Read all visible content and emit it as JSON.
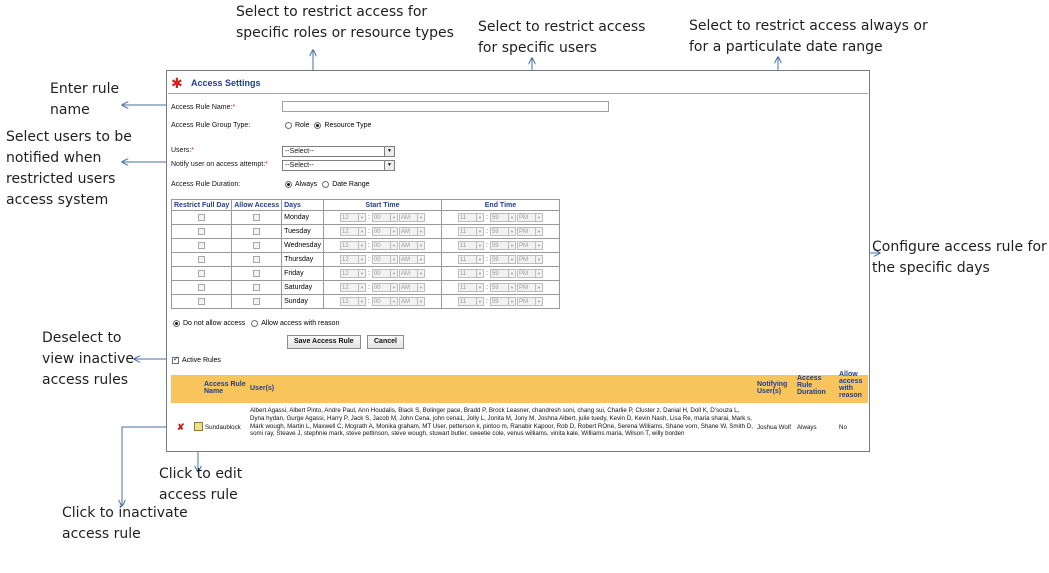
{
  "callouts": {
    "roles": [
      "Select to restrict access for",
      "specific roles or resource types"
    ],
    "users": [
      "Select to restrict access",
      "for specific users"
    ],
    "duration": [
      "Select to restrict access always or",
      "for a particulate date range"
    ],
    "rule_name": [
      "Enter rule",
      "name"
    ],
    "notify": [
      "Select users to be",
      "notified when",
      "restricted users",
      "access system"
    ],
    "days": [
      "Configure access rule for",
      "the specific days"
    ],
    "inactive": [
      "Deselect to",
      "view inactive",
      "access rules"
    ],
    "edit": [
      "Click to edit",
      "access rule"
    ],
    "inactivate": [
      "Click to inactivate",
      "access rule"
    ]
  },
  "panel": {
    "title": "Access Settings",
    "rule_name_label": "Access Rule Name:",
    "required_mark": "*",
    "group_type_label": "Access Rule Group Type:",
    "group_type_options": [
      "Role",
      "Resource Type"
    ],
    "group_type_selected": "Resource Type",
    "users_label": "Users:",
    "users_value": "--Select--",
    "notify_label": "Notify user on access attempt:",
    "notify_value": "--Select--",
    "duration_label": "Access Rule Duration:",
    "duration_options": [
      "Always",
      "Date Range"
    ],
    "duration_selected": "Always"
  },
  "schedule": {
    "headers": [
      "Restrict Full Day",
      "Allow Access",
      "Days",
      "Start Time",
      "End Time"
    ],
    "days": [
      "Monday",
      "Tuesday",
      "Wednesday",
      "Thursday",
      "Friday",
      "Saturday",
      "Sunday"
    ],
    "start": {
      "hour": "12",
      "minute": "00",
      "ampm": "AM"
    },
    "end": {
      "hour": "11",
      "minute": "59",
      "ampm": "PM"
    }
  },
  "access_options": [
    "Do not allow access",
    "Allow access with reason"
  ],
  "access_selected": "Do not allow access",
  "buttons": {
    "save": "Save Access Rule",
    "cancel": "Cancel"
  },
  "active_rules_label": "Active Rules",
  "rules_table": {
    "headers": {
      "name": "Access Rule Name",
      "users": "User(s)",
      "notifying": "Notifying User(s)",
      "duration": "Access Rule Duration",
      "allow": "Allow access with reason"
    },
    "rows": [
      {
        "name": "Sundaublock",
        "users": "Albert Agassi, Albert Pinto, Andre Paul, Ann Houdalis, Black S, Bolinger pace, Bradd P, Brock Leasner, chandresh soni, chang sui, Charlie P, Cluster z, Danial H, Doll K, D'souza L, Dyna hydan, Gurge Agassi, Harry P, Jack S, Jacob M, John Cena, john cena1, Jolly L, Jonita M, Jony M, Joshna Albert, julie tuedy, Kevin D, Kevin Nash, Lisa Re, maria sharai, Mark s, Mark wough, Martin L, Maxwell C, Mcgrath A, Monika graham, MT User, petterson k, pintoo m, Ranabir Kapoor, Rob D, Robert ROne, Serena Williams, Shane vorn, Shane W, Smith D, somi ray, Steave J, stephnie mark, steve pettinson, steve wough, stuwart butler, sweetie cole, venus williams, vinita kale, Williams maria, Wilson T, willy borden",
        "notifying": "Joshua Wolf",
        "duration": "Always",
        "allow": "No"
      }
    ]
  }
}
